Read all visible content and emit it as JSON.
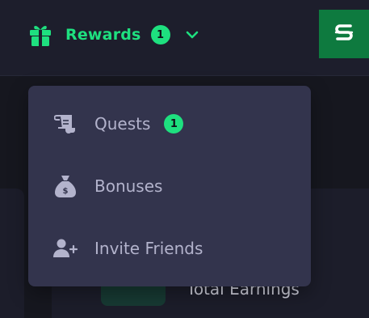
{
  "header": {
    "rewards_label": "Rewards",
    "rewards_count": "1",
    "icons": {
      "rewards": "gift-icon",
      "dropdown": "chevron-down-icon",
      "brand": "brand-logo-icon"
    }
  },
  "menu": {
    "items": [
      {
        "label": "Quests",
        "icon": "scroll-icon",
        "badge": "1"
      },
      {
        "label": "Bonuses",
        "icon": "money-bag-icon"
      },
      {
        "label": "Invite Friends",
        "icon": "add-user-icon"
      }
    ]
  },
  "background": {
    "earnings_label": "Total Earnings"
  },
  "colors": {
    "accent": "#1ee07f",
    "brand": "#0e7a3f",
    "dropdown_bg": "#33344d",
    "menu_text": "#b3b3cc"
  }
}
